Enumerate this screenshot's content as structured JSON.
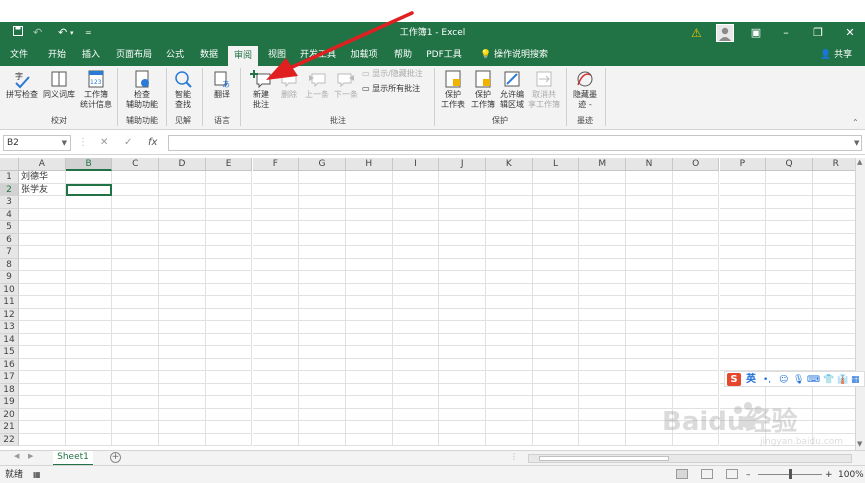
{
  "window": {
    "title": "工作簿1  -  Excel",
    "quick_access": [
      "save-icon",
      "undo-icon",
      "redo-icon",
      "customize-icon"
    ]
  },
  "tabs": [
    "文件",
    "开始",
    "插入",
    "页面布局",
    "公式",
    "数据",
    "审阅",
    "视图",
    "开发工具",
    "加载项",
    "帮助",
    "PDF工具",
    "操作说明搜索"
  ],
  "active_tab": "审阅",
  "share_label": "共享",
  "ribbon": {
    "proofing": {
      "spell": "拼写检查",
      "thesaurus": "同义词库",
      "stats_line1": "工作簿",
      "stats_line2": "统计信息",
      "group": "校对"
    },
    "accessibility": {
      "check_line1": "检查",
      "check_line2": "辅助功能",
      "group": "辅助功能"
    },
    "insights": {
      "smart_line1": "智能",
      "smart_line2": "查找",
      "group": "见解"
    },
    "language": {
      "translate": "翻译",
      "group": "语言"
    },
    "comments": {
      "new_line1": "新建",
      "new_line2": "批注",
      "delete": "删除",
      "prev": "上一条",
      "next": "下一条",
      "show_hide": "显示/隐藏批注",
      "show_all": "显示所有批注",
      "group": "批注"
    },
    "protect": {
      "sheet_line1": "保护",
      "sheet_line2": "工作表",
      "workbook_line1": "保护",
      "workbook_line2": "工作簿",
      "allow_line1": "允许编",
      "allow_line2": "辑区域",
      "unshare_line1": "取消共",
      "unshare_line2": "享工作簿",
      "group": "保护"
    },
    "ink": {
      "hide_line1": "隐藏墨",
      "hide_line2": "迹 -",
      "group": "墨迹"
    }
  },
  "formula_bar": {
    "name_box": "B2",
    "cancel": "✕",
    "enter": "✓",
    "fx": "fx",
    "value": ""
  },
  "sheet": {
    "columns": [
      "A",
      "B",
      "C",
      "D",
      "E",
      "F",
      "G",
      "H",
      "I",
      "J",
      "K",
      "L",
      "M",
      "N",
      "O",
      "P",
      "Q",
      "R"
    ],
    "rows": [
      "1",
      "2",
      "3",
      "4",
      "5",
      "6",
      "7",
      "8",
      "9",
      "10",
      "11",
      "12",
      "13",
      "14",
      "15",
      "16",
      "17",
      "18",
      "19",
      "20",
      "21",
      "22"
    ],
    "cells": {
      "A1": "刘德华",
      "A2": "张学友"
    },
    "selected_cell": "B2"
  },
  "sheet_tab": "Sheet1",
  "status": {
    "ready": "就绪",
    "zoom": "100%"
  },
  "ime": {
    "language": "英"
  },
  "watermark": {
    "text": "Baidu经验",
    "url": "jingyan.baidu.com"
  },
  "colors": {
    "excel_green": "#217346",
    "annotation_red": "#e02020"
  }
}
